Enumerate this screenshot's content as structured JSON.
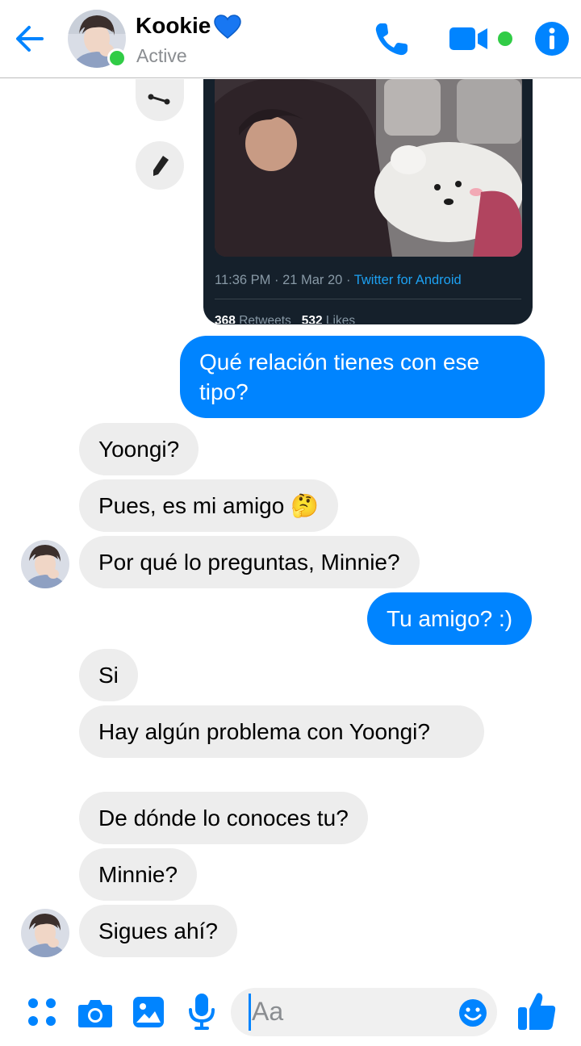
{
  "header": {
    "contact_name": "Kookie",
    "status": "Active",
    "icons": {
      "back": "arrow-left-icon",
      "heart": "blue-heart-icon",
      "phone": "phone-icon",
      "video": "video-camera-icon",
      "info": "info-icon"
    }
  },
  "tweet": {
    "time_date": "11:36 PM · 21 Mar 20 · ",
    "source": "Twitter for Android",
    "retweets_count": "368",
    "retweets_label": "Retweets",
    "likes_count": "532",
    "likes_label": "Likes"
  },
  "messages": [
    {
      "sender": "me",
      "text": "Qué relación tienes con ese tipo?"
    },
    {
      "sender": "them",
      "text": "Yoongi?"
    },
    {
      "sender": "them",
      "text": "Pues, es mi amigo",
      "emoji": "🤔"
    },
    {
      "sender": "them",
      "text": "Por qué lo preguntas, Minnie?"
    },
    {
      "sender": "me",
      "text": "Tu amigo? :)"
    },
    {
      "sender": "them",
      "text": "Si"
    },
    {
      "sender": "them",
      "text": "Hay algún problema con Yoongi?"
    },
    {
      "sender": "them",
      "text": "De dónde lo conoces tu?"
    },
    {
      "sender": "them",
      "text": "Minnie?"
    },
    {
      "sender": "them",
      "text": "Sigues ahí?"
    }
  ],
  "composer": {
    "placeholder": "Aa",
    "icons": [
      "grid-dots-icon",
      "camera-icon",
      "image-icon",
      "microphone-icon",
      "emoji-icon",
      "thumbs-up-icon"
    ]
  },
  "colors": {
    "accent": "#0084ff",
    "active_green": "#31cc46",
    "incoming_bubble": "#ededed",
    "tweet_bg": "#15202b",
    "tweet_link": "#1da1f2"
  }
}
